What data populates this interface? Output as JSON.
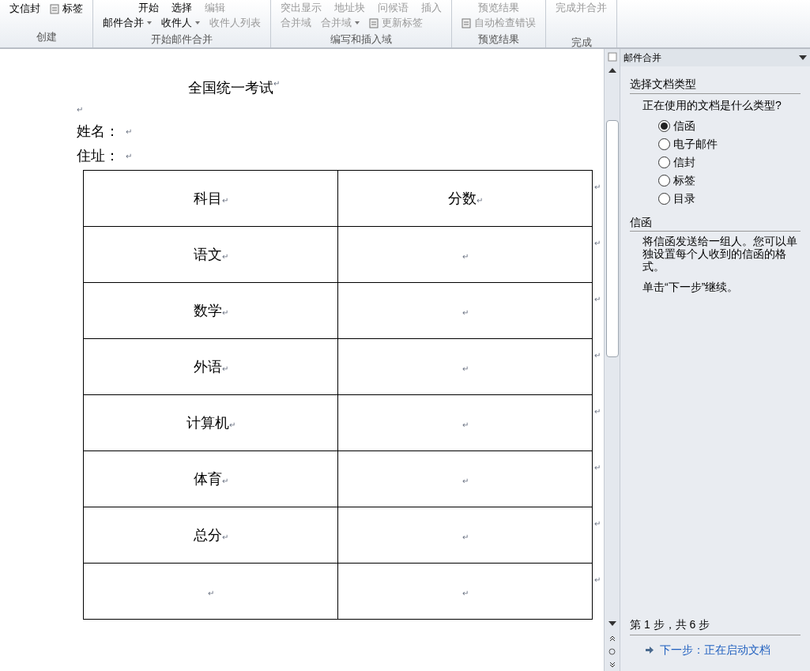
{
  "ribbon": {
    "groups": [
      {
        "label": "创建",
        "items": [
          {
            "text": "文信封",
            "kind": "plain"
          },
          {
            "text": "标签",
            "kind": "icon"
          }
        ]
      },
      {
        "label": "开始邮件合并",
        "items": [
          {
            "text": "开始",
            "kind": "top"
          },
          {
            "text": "选择",
            "kind": "top"
          },
          {
            "text": "编辑",
            "kind": "top-disabled"
          },
          {
            "text": "邮件合并",
            "kind": "dropdown"
          },
          {
            "text": "收件人",
            "kind": "dropdown"
          },
          {
            "text": "收件人列表",
            "kind": "disabled"
          }
        ]
      },
      {
        "label": "编写和插入域",
        "items": [
          {
            "text": "突出显示",
            "kind": "top-disabled"
          },
          {
            "text": "地址块",
            "kind": "top-disabled"
          },
          {
            "text": "问候语",
            "kind": "top-disabled"
          },
          {
            "text": "插入",
            "kind": "top-disabled"
          },
          {
            "text": "合并域",
            "kind": "disabled"
          },
          {
            "text": "合并域",
            "kind": "dropdown-disabled"
          },
          {
            "text": "更新标签",
            "kind": "icon-disabled"
          }
        ]
      },
      {
        "label": "预览结果",
        "items": [
          {
            "text": "预览结果",
            "kind": "top-disabled"
          },
          {
            "text": "自动检查错误",
            "kind": "icon-disabled"
          }
        ]
      },
      {
        "label": "完成",
        "items": [
          {
            "text": "完成并合并",
            "kind": "top-disabled"
          }
        ]
      }
    ]
  },
  "document": {
    "title": {
      "text": "全国统一考试",
      "mark": "↵"
    },
    "blank_line": {
      "mark": "↵"
    },
    "fields": [
      {
        "text": "姓名：",
        "mark": "↵"
      },
      {
        "text": "住址：",
        "mark": "↵"
      }
    ],
    "table": {
      "columns": [
        {
          "text": "科目",
          "mark": "↵"
        },
        {
          "text": "分数",
          "mark": "↵"
        }
      ],
      "row_end_mark": "↵",
      "rows": [
        [
          {
            "text": "语文",
            "mark": "↵"
          },
          {
            "text": "",
            "mark": "↵"
          }
        ],
        [
          {
            "text": "数学",
            "mark": "↵"
          },
          {
            "text": "",
            "mark": "↵"
          }
        ],
        [
          {
            "text": "外语",
            "mark": "↵"
          },
          {
            "text": "",
            "mark": "↵"
          }
        ],
        [
          {
            "text": "计算机",
            "mark": "↵"
          },
          {
            "text": "",
            "mark": "↵"
          }
        ],
        [
          {
            "text": "体育",
            "mark": "↵"
          },
          {
            "text": "",
            "mark": "↵"
          }
        ],
        [
          {
            "text": "总分",
            "mark": "↵"
          },
          {
            "text": "",
            "mark": "↵"
          }
        ],
        [
          {
            "text": "",
            "mark": "↵"
          },
          {
            "text": "",
            "mark": "↵"
          }
        ]
      ]
    }
  },
  "task_pane": {
    "title": "邮件合并",
    "section1": "选择文档类型",
    "question": "正在使用的文档是什么类型?",
    "options": [
      {
        "label": "信函",
        "selected": true
      },
      {
        "label": "电子邮件",
        "selected": false
      },
      {
        "label": "信封",
        "selected": false
      },
      {
        "label": "标签",
        "selected": false
      },
      {
        "label": "目录",
        "selected": false
      }
    ],
    "section2": "信函",
    "description": "将信函发送给一组人。您可以单独设置每个人收到的信函的格式。",
    "hint": "单击“下一步”继续。",
    "step": "第 1 步，共 6 步",
    "next_link": "下一步：正在启动文档"
  }
}
